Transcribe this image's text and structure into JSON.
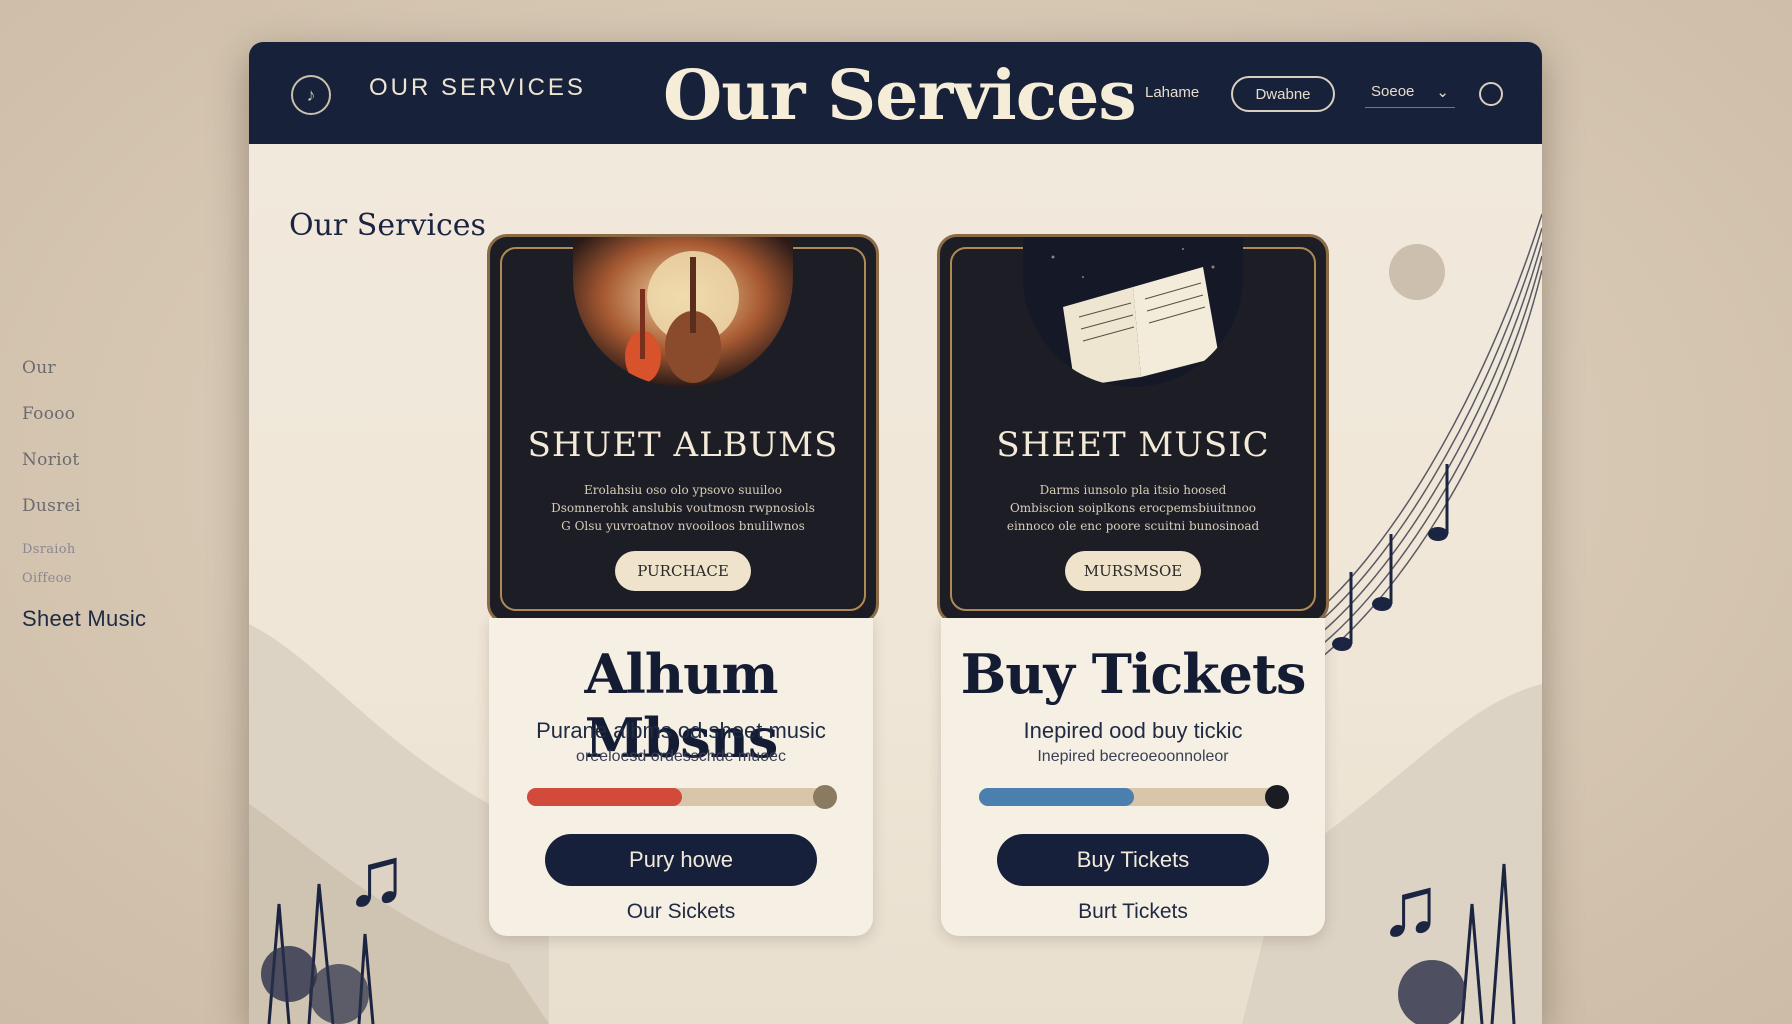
{
  "side_nav": {
    "items": [
      {
        "label": "Our",
        "style": "normal"
      },
      {
        "label": "Foooo",
        "style": "normal"
      },
      {
        "label": "Noriot",
        "style": "normal"
      },
      {
        "label": "Dusrei",
        "style": "normal"
      },
      {
        "label": "Dsraioh",
        "style": "faint"
      },
      {
        "label": "Oiffeoe",
        "style": "faint"
      }
    ],
    "active_label": "Sheet Music"
  },
  "header": {
    "brand": "OUR SERVICES",
    "title": "Our Services",
    "nav_link": "Lahame",
    "nav_pill": "Dwabne",
    "nav_select": "Soeoe"
  },
  "main": {
    "section_title": "Our Services",
    "cards": [
      {
        "title": "SHUET ALBUMS",
        "desc_lines": [
          "Erolahsiu oso olo ypsovo suuiloo",
          "Dsomnerohk anslubis voutmosn rwpnosiols",
          "G Olsu yuvroatnov nvooiloos bnulilwnos"
        ],
        "button": "PURCHACE",
        "icon": "guitar-icon"
      },
      {
        "title": "SHEET MUSIC",
        "desc_lines": [
          "Darms iunsolo pla itsio hoosed",
          "Ombiscion soiplkons erocpemsbiuitnnoo",
          "einnoco ole enc poore scuitni bunosinoad"
        ],
        "button": "MURSMSOE",
        "icon": "sheet-music-icon"
      }
    ],
    "panels": [
      {
        "title": "Alhum Mbsns",
        "subtitle": "Purane albms od sheet music",
        "subtitle2": "oreeloesd ordesschde muoec",
        "progress": 0.5,
        "progress_color": "#d24a3c",
        "button": "Pury howe",
        "link": "Our Sickets"
      },
      {
        "title": "Buy Tickets",
        "subtitle": "Inepired ood buy tickic",
        "subtitle2": "Inepired becreoeoonnoleor",
        "progress": 0.5,
        "progress_color": "#4a7fb0",
        "button": "Buy Tickets",
        "link": "Burt Tickets"
      }
    ]
  },
  "colors": {
    "navy": "#18213a",
    "cream": "#efe7da",
    "accent_red": "#d24a3c",
    "accent_blue": "#4a7fb0"
  }
}
